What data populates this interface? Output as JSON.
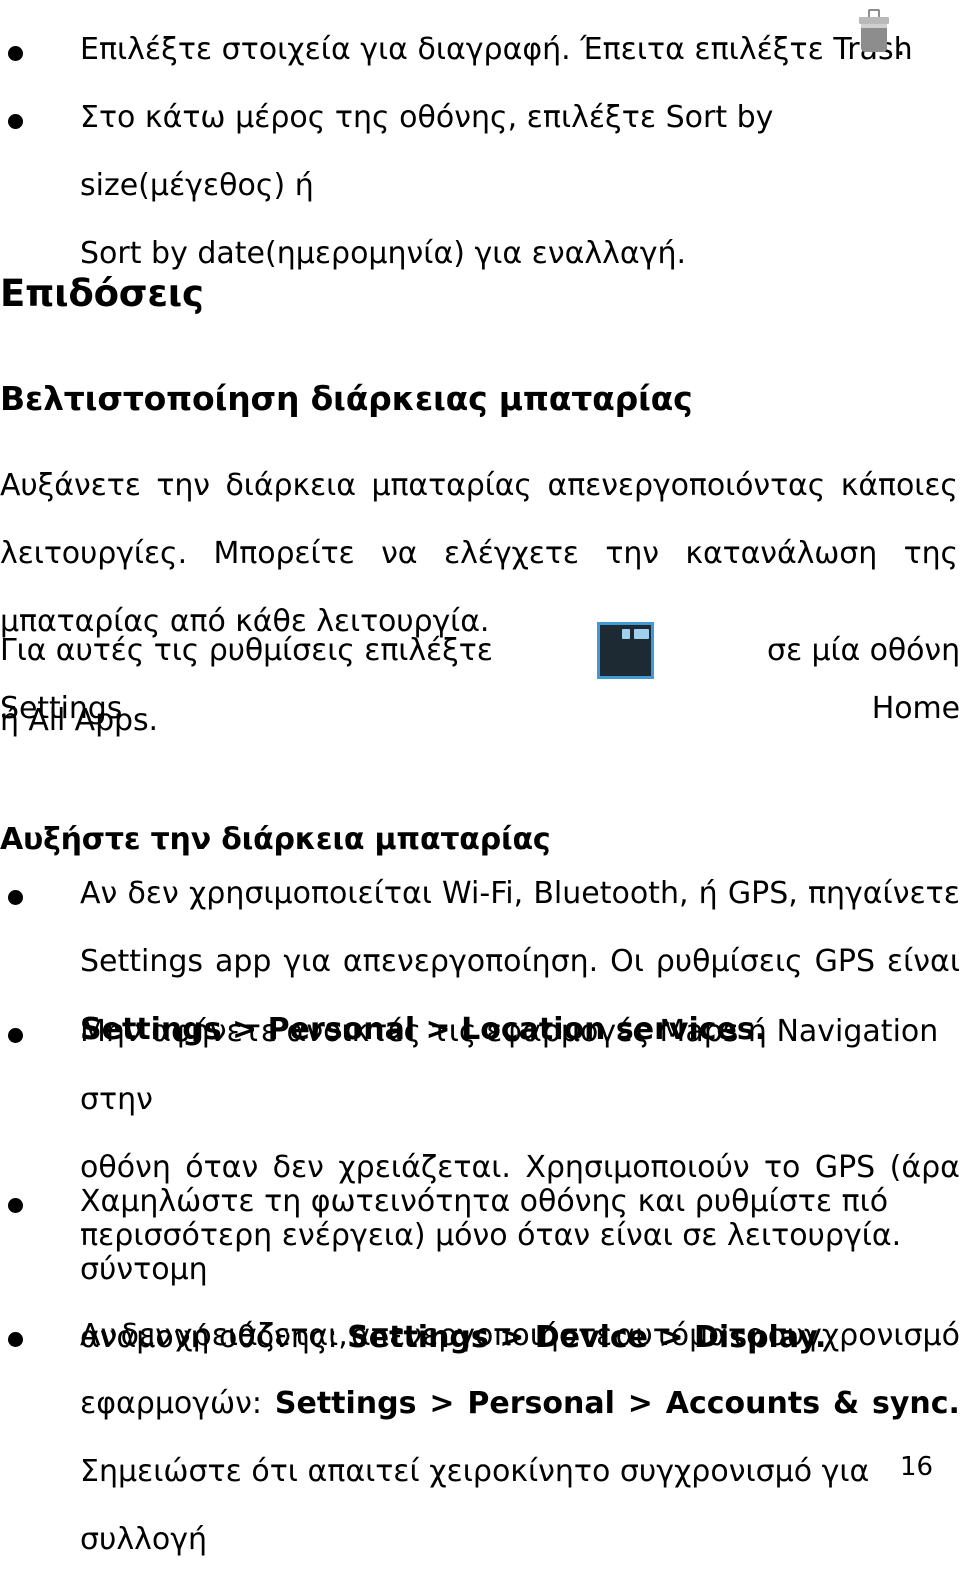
{
  "document": {
    "page_number": "16",
    "colors": {
      "text": "#000000",
      "background": "#ffffff",
      "settings_icon_accent": "#3f9ad6",
      "settings_icon_background": "#1e2a33",
      "trash_icon_gray": "#8d8d8d"
    }
  },
  "top_bullets": [
    {
      "lines": [
        "Επιλέξτε στοιχεία για διαγραφή. Έπειτα επιλέξτε Trash"
      ],
      "trailing": ".",
      "icon": "trash-icon"
    },
    {
      "lines": [
        "Στο κάτω μέρος της οθόνης, επιλέξτε Sort by size(μέγεθος) ή",
        "Sort by date(ημερομηνία) για εναλλαγή."
      ]
    }
  ],
  "section_heading": "Επιδόσεις",
  "subsection_heading": "Βελτιστοποίηση διάρκειας μπαταρίας",
  "intro_paragraph": {
    "lines": [
      "Αυξάνετε την διάρκεια μπαταρίας απενεργοποιόντας κάποιες",
      "λειτουργίες.    Μπορείτε να ελέγχετε την κατανάλωση της",
      "μπαταρίας από κάθε λειτουργία."
    ]
  },
  "settings_sentence": {
    "before_icon": "Για αυτές τις ρυθμίσεις επιλέξτε Settings",
    "icon": "settings-sliders-icon",
    "after_icon": "σε μία οθόνη Home",
    "second_line": "ή All Apps."
  },
  "battery_heading": "Αυξήστε την διάρκεια μπαταρίας",
  "battery_bullets": [
    {
      "line1": "Αν δεν χρησιμοποιείται Wi-Fi, Bluetooth, ή GPS, πηγαίνετε",
      "line2": "Settings app για απενεργοποίηση.   Οι ρυθμίσεις GPS είναι",
      "line3_bold": "Settings > Personal > Location services."
    },
    {
      "line1": "Μην αφήνετε ανοικτές τις εφαρμογές Maps ή Navigation στην",
      "line2": "οθόνη όταν δεν χρειάζεται. Χρησιμοποιούν το GPS (άρα",
      "line3": "περισσότερη ενέργεια) μόνο όταν είναι σε λειτουργία."
    },
    {
      "line1": "Χαμηλώστε τη φωτεινότητα οθόνης και ρυθμίστε πιό σύντομη",
      "line2_prefix": "αναμονή οθόνης: ",
      "line2_bold": "Settings > Device > Display."
    },
    {
      "line1": "Αν δεν χρειάζεται, απενεργοποιήστε αυτόματο συγχρονισμό",
      "line2_prefix": "εφαρμογών: ",
      "line2_bold": "Settings > Personal > Accounts & sync.",
      "line3": "Σημειώστε ότι απαιτεί χειροκίνητο συγχρονισμό για συλλογή"
    }
  ]
}
